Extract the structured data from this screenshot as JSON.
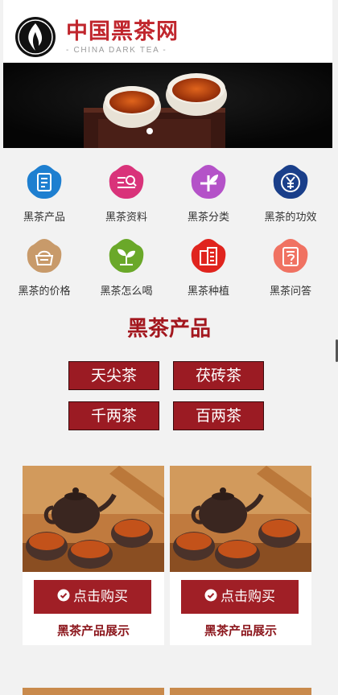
{
  "header": {
    "brand_name": "中国黑茶网",
    "brand_sub": "- CHINA DARK TEA -"
  },
  "nav": [
    {
      "label": "黑茶产品",
      "icon": "document-icon",
      "color": "#1e7fd0"
    },
    {
      "label": "黑茶资料",
      "icon": "search-list-icon",
      "color": "#d9337a"
    },
    {
      "label": "黑茶分类",
      "icon": "leaf-icon",
      "color": "#b452c8"
    },
    {
      "label": "黑茶的功效",
      "icon": "yen-icon",
      "color": "#1a3f8a"
    },
    {
      "label": "黑茶的价格",
      "icon": "basket-icon",
      "color": "#c89a6a"
    },
    {
      "label": "黑茶怎么喝",
      "icon": "sprout-icon",
      "color": "#6aa829"
    },
    {
      "label": "黑茶种植",
      "icon": "building-icon",
      "color": "#e0241e"
    },
    {
      "label": "黑茶问答",
      "icon": "question-doc-icon",
      "color": "#f07262"
    }
  ],
  "section": {
    "title": "黑茶产品",
    "categories": [
      "天尖茶",
      "茯砖茶",
      "千两茶",
      "百两茶"
    ]
  },
  "products": [
    {
      "buy_label": "点击购买",
      "title": "黑茶产品展示"
    },
    {
      "buy_label": "点击购买",
      "title": "黑茶产品展示"
    }
  ],
  "colors": {
    "brand_red": "#c0262d",
    "button_red": "#9b1b23"
  }
}
